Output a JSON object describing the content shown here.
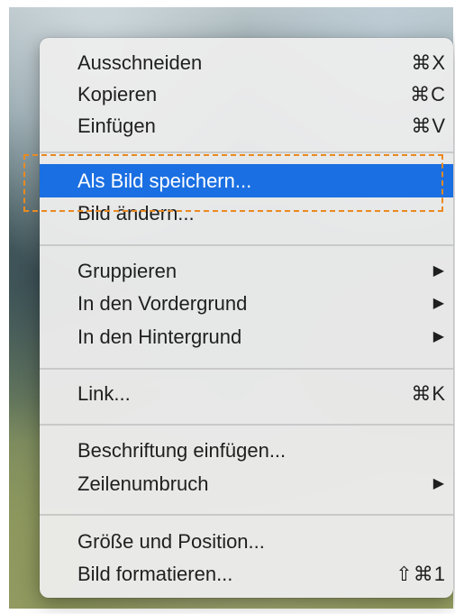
{
  "menu": {
    "groups": [
      {
        "items": [
          {
            "label": "Ausschneiden",
            "shortcut": "⌘X"
          },
          {
            "label": "Kopieren",
            "shortcut": "⌘C"
          },
          {
            "label": "Einfügen",
            "shortcut": "⌘V"
          }
        ]
      },
      {
        "items": [
          {
            "label": "Als Bild speichern...",
            "selected": true
          },
          {
            "label": "Bild ändern..."
          }
        ]
      },
      {
        "items": [
          {
            "label": "Gruppieren",
            "submenu": "▶"
          },
          {
            "label": "In den Vordergrund",
            "submenu": "▶"
          },
          {
            "label": "In den Hintergrund",
            "submenu": "▶"
          }
        ]
      },
      {
        "items": [
          {
            "label": "Link...",
            "shortcut": "⌘K"
          }
        ]
      },
      {
        "items": [
          {
            "label": "Beschriftung einfügen..."
          },
          {
            "label": "Zeilenumbruch",
            "submenu": "▶"
          }
        ]
      },
      {
        "items": [
          {
            "label": "Größe und Position..."
          },
          {
            "label": "Bild formatieren...",
            "shortcut": "⇧⌘1"
          }
        ]
      }
    ]
  },
  "colors": {
    "selection": "#1a6fe2",
    "annotation_dashed_border": "#e98a21"
  }
}
